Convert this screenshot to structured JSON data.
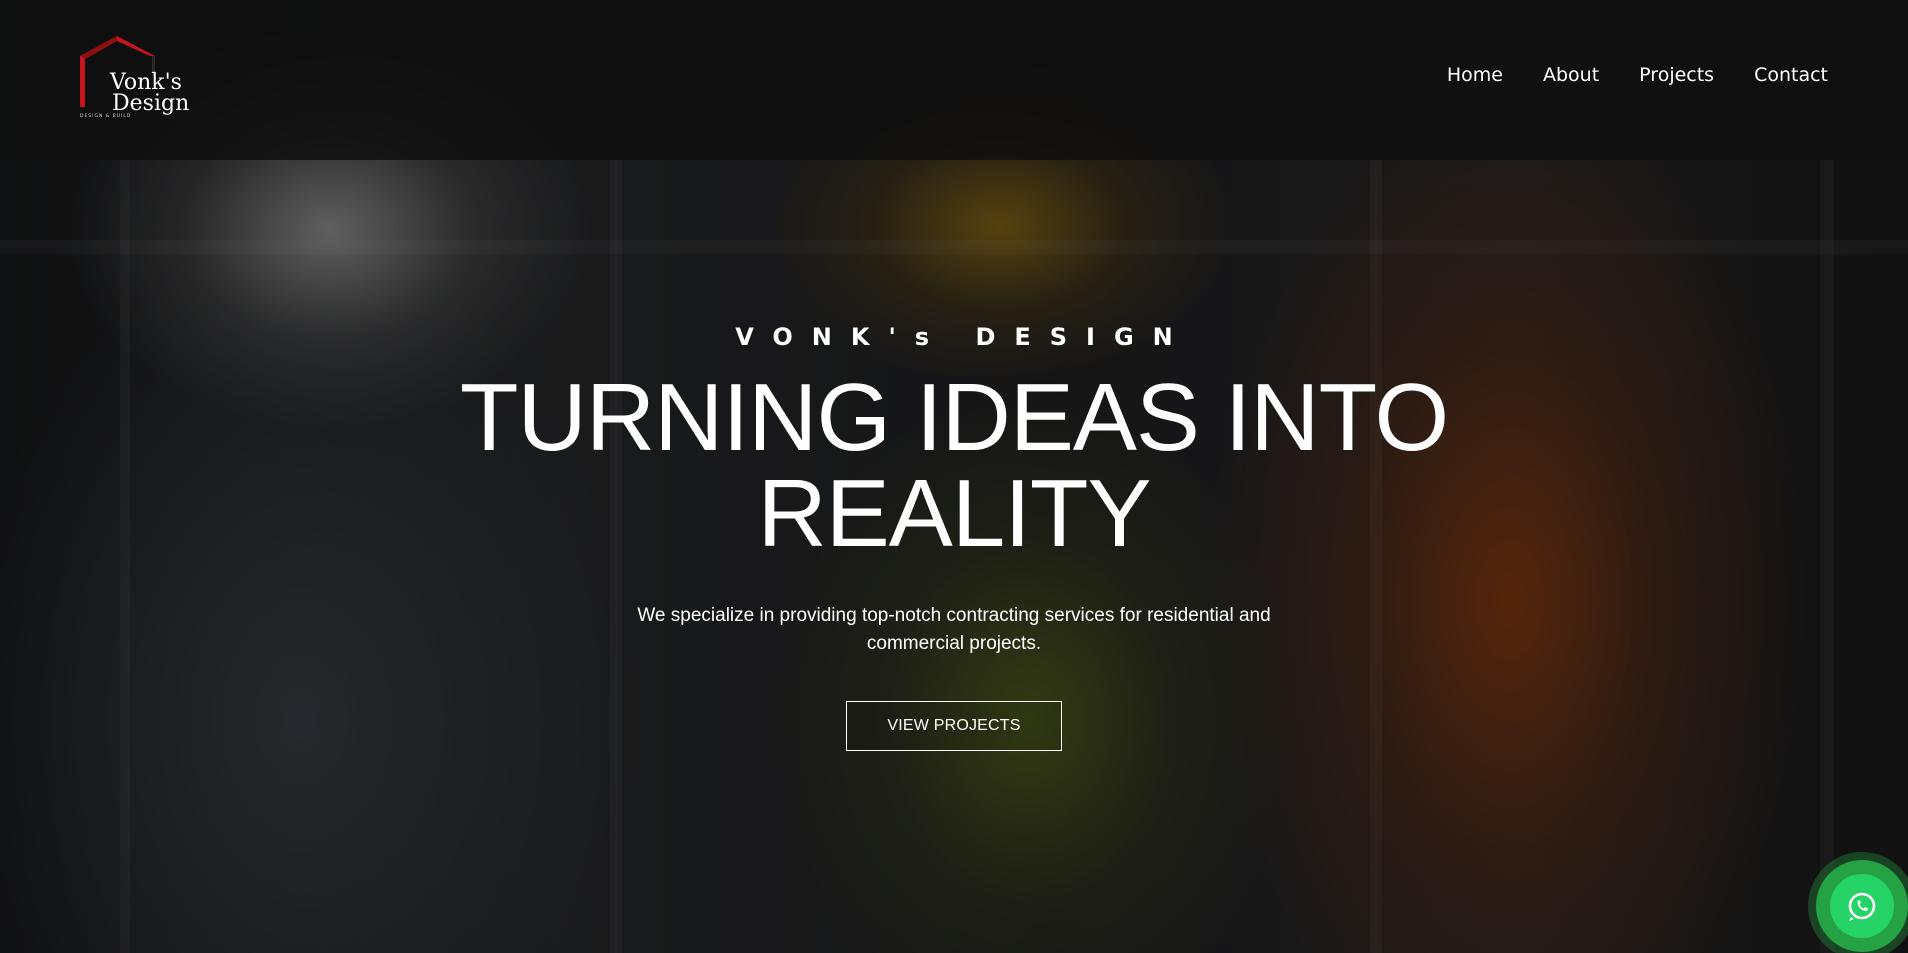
{
  "brand": {
    "name_line1": "Vonk's",
    "name_line2": "Design",
    "tagline": "DESIGN & BUILD",
    "logo_accent": "#c4161c"
  },
  "nav": {
    "items": [
      "Home",
      "About",
      "Projects",
      "Contact"
    ]
  },
  "hero": {
    "kicker": "VONK's DESIGN",
    "headline": "TURNING IDEAS INTO REALITY",
    "subtext": "We specialize in providing top-notch contracting services for residential and commercial projects.",
    "cta_label": "VIEW PROJECTS"
  },
  "whatsapp": {
    "icon": "whatsapp-icon",
    "color": "#25d366"
  }
}
